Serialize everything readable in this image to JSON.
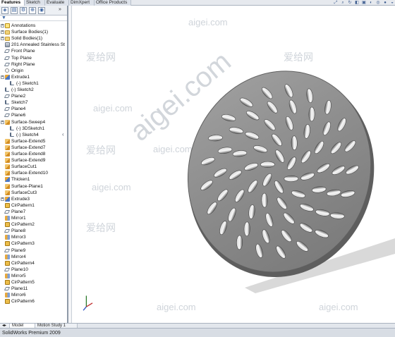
{
  "tabs": [
    {
      "label": "Features",
      "active": true
    },
    {
      "label": "Sketch",
      "active": false
    },
    {
      "label": "Evaluate",
      "active": false
    },
    {
      "label": "DimXpert",
      "active": false
    },
    {
      "label": "Office Products",
      "active": false
    }
  ],
  "feature_tree": [
    {
      "label": "Annotations",
      "icon": "annotations-icon",
      "indent": 1,
      "expander": true
    },
    {
      "label": "Surface Bodies(1)",
      "icon": "folder-icon",
      "indent": 1,
      "expander": true
    },
    {
      "label": "Solid Bodies(1)",
      "icon": "folder-icon",
      "indent": 1,
      "expander": true
    },
    {
      "label": "201 Annealed Stainless St",
      "icon": "material-icon",
      "indent": 1,
      "expander": false
    },
    {
      "label": "Front Plane",
      "icon": "plane-icon",
      "indent": 1,
      "expander": false
    },
    {
      "label": "Top Plane",
      "icon": "plane-icon",
      "indent": 1,
      "expander": false
    },
    {
      "label": "Right Plane",
      "icon": "plane-icon",
      "indent": 1,
      "expander": false
    },
    {
      "label": "Origin",
      "icon": "origin-icon",
      "indent": 1,
      "expander": false
    },
    {
      "label": "Extrude1",
      "icon": "feature-icon",
      "indent": 1,
      "expander": true
    },
    {
      "label": "(-) Sketch1",
      "icon": "sketch-icon",
      "indent": 2,
      "expander": false
    },
    {
      "label": "(-) Sketch2",
      "icon": "sketch-icon",
      "indent": 1,
      "expander": false
    },
    {
      "label": "Plane2",
      "icon": "plane-icon",
      "indent": 1,
      "expander": false
    },
    {
      "label": "Sketch7",
      "icon": "sketch-icon",
      "indent": 1,
      "expander": false
    },
    {
      "label": "Plane4",
      "icon": "plane-icon",
      "indent": 1,
      "expander": false
    },
    {
      "label": "Plane6",
      "icon": "plane-icon",
      "indent": 1,
      "expander": false
    },
    {
      "label": "Surface-Sweep4",
      "icon": "surface-icon",
      "indent": 1,
      "expander": true
    },
    {
      "label": "(-) 3DSketch1",
      "icon": "sketch-icon",
      "indent": 2,
      "expander": false
    },
    {
      "label": "(-) Sketch4",
      "icon": "sketch-icon",
      "indent": 2,
      "expander": false
    },
    {
      "label": "Surface-Extend5",
      "icon": "surface-icon",
      "indent": 1,
      "expander": false
    },
    {
      "label": "Surface-Extend7",
      "icon": "surface-icon",
      "indent": 1,
      "expander": false
    },
    {
      "label": "Surface-Extend8",
      "icon": "surface-icon",
      "indent": 1,
      "expander": false
    },
    {
      "label": "Surface-Extend9",
      "icon": "surface-icon",
      "indent": 1,
      "expander": false
    },
    {
      "label": "SurfaceCut1",
      "icon": "surface-icon",
      "indent": 1,
      "expander": false
    },
    {
      "label": "Surface-Extend10",
      "icon": "surface-icon",
      "indent": 1,
      "expander": false
    },
    {
      "label": "Thicken1",
      "icon": "feature-icon",
      "indent": 1,
      "expander": false
    },
    {
      "label": "Surface-Plane1",
      "icon": "surface-icon",
      "indent": 1,
      "expander": false
    },
    {
      "label": "SurfaceCut3",
      "icon": "surface-icon",
      "indent": 1,
      "expander": false
    },
    {
      "label": "Extrude3",
      "icon": "feature-icon",
      "indent": 1,
      "expander": true
    },
    {
      "label": "CirPattern1",
      "icon": "pattern-icon",
      "indent": 1,
      "expander": false
    },
    {
      "label": "Plane7",
      "icon": "plane-icon",
      "indent": 1,
      "expander": false
    },
    {
      "label": "Mirror1",
      "icon": "mirror-icon",
      "indent": 1,
      "expander": false
    },
    {
      "label": "CirPattern2",
      "icon": "pattern-icon",
      "indent": 1,
      "expander": false
    },
    {
      "label": "Plane8",
      "icon": "plane-icon",
      "indent": 1,
      "expander": false
    },
    {
      "label": "Mirror3",
      "icon": "mirror-icon",
      "indent": 1,
      "expander": false
    },
    {
      "label": "CirPattern3",
      "icon": "pattern-icon",
      "indent": 1,
      "expander": false
    },
    {
      "label": "Plane9",
      "icon": "plane-icon",
      "indent": 1,
      "expander": false
    },
    {
      "label": "Mirror4",
      "icon": "mirror-icon",
      "indent": 1,
      "expander": false
    },
    {
      "label": "CirPattern4",
      "icon": "pattern-icon",
      "indent": 1,
      "expander": false
    },
    {
      "label": "Plane10",
      "icon": "plane-icon",
      "indent": 1,
      "expander": false
    },
    {
      "label": "Mirror5",
      "icon": "mirror-icon",
      "indent": 1,
      "expander": false
    },
    {
      "label": "CirPattern5",
      "icon": "pattern-icon",
      "indent": 1,
      "expander": false
    },
    {
      "label": "Plane11",
      "icon": "plane-icon",
      "indent": 1,
      "expander": false
    },
    {
      "label": "Mirror6",
      "icon": "mirror-icon",
      "indent": 1,
      "expander": false
    },
    {
      "label": "CirPattern6",
      "icon": "pattern-icon",
      "indent": 1,
      "expander": false
    }
  ],
  "bottom_tabs": [
    {
      "label": "Model",
      "active": true
    },
    {
      "label": "Motion Study 1",
      "active": false
    }
  ],
  "status": {
    "text": "SolidWorks Premium 2009"
  },
  "watermarks": [
    "aigei.com",
    "爱给网"
  ],
  "colors": {
    "disc": "#8e8e8e",
    "disc_edge": "#5e5e5e",
    "hole": "#f0f0f0",
    "shadow": "#d6d6d6"
  }
}
